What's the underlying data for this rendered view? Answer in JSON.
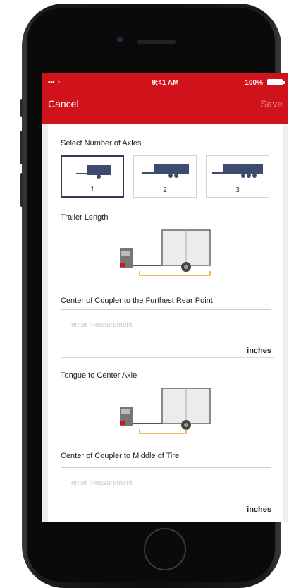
{
  "status_bar": {
    "time": "9:41 AM",
    "battery": "100%",
    "signal": "••• ◔"
  },
  "nav": {
    "cancel_label": "Cancel",
    "save_label": "Save"
  },
  "axles": {
    "title": "Select Number of Axles",
    "options": [
      {
        "label": "1",
        "selected": true
      },
      {
        "label": "2",
        "selected": false
      },
      {
        "label": "3",
        "selected": false
      }
    ]
  },
  "trailer_length": {
    "title": "Trailer Length",
    "field_label": "Center of Coupler to the Furthest Rear Point",
    "placeholder": "enter measurement",
    "unit": "inches"
  },
  "tongue": {
    "title": "Tongue to Center Axle",
    "field_label": "Center of Coupler to Middle of Tire",
    "placeholder": "enter measurement",
    "unit": "inches"
  },
  "colors": {
    "brand_red": "#d0121b",
    "trailer_navy": "#3d4c6e",
    "dimension_line": "#f0a020"
  }
}
